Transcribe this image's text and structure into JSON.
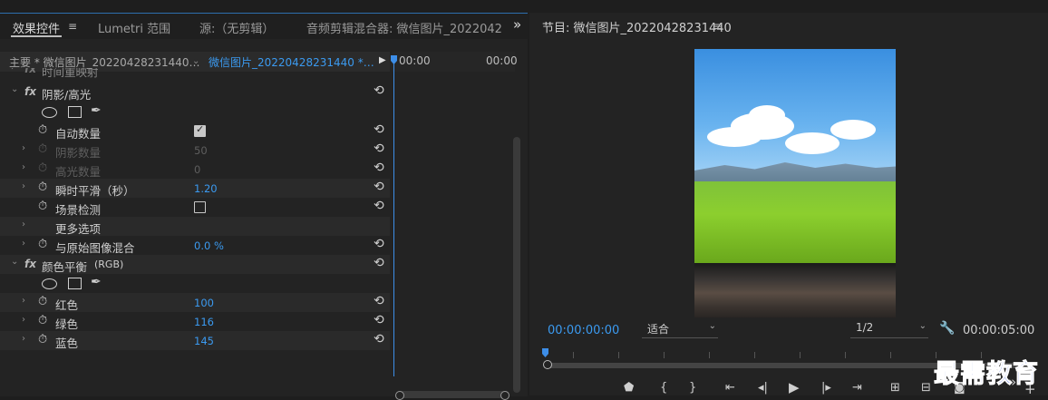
{
  "tabs": [
    "效果控件",
    "Lumetri 范围",
    "源:（无剪辑）",
    "音频剪辑混合器: 微信图片_2022042"
  ],
  "panel_overflow": "»",
  "clip": {
    "master": "主要 * 微信图片_20220428231440…",
    "sequence": "微信图片_20220428231440 *…",
    "tc_start": "00:00",
    "tc_end": "00:00"
  },
  "effects": {
    "partial_row": "时间重映射",
    "shadow_highlight": {
      "title": "阴影/高光",
      "auto_amount": {
        "label": "自动数量",
        "checked": true
      },
      "shadow_amount": {
        "label": "阴影数量",
        "value": "50"
      },
      "highlight_amount": {
        "label": "高光数量",
        "value": "0"
      },
      "temporal_smoothing": {
        "label": "瞬时平滑（秒）",
        "value": "1.20"
      },
      "scene_detect": {
        "label": "场景检测",
        "checked": false
      },
      "more_options": {
        "label": "更多选项"
      },
      "blend_original": {
        "label": "与原始图像混合",
        "value": "0.0 %"
      }
    },
    "color_balance": {
      "title": "颜色平衡",
      "suffix": "(RGB)",
      "red": {
        "label": "红色",
        "value": "100"
      },
      "green": {
        "label": "绿色",
        "value": "116"
      },
      "blue": {
        "label": "蓝色",
        "value": "145"
      }
    }
  },
  "program": {
    "title": "节目: 微信图片_20220428231440",
    "timecode_current": "00:00:00:00",
    "fit": "适合",
    "resolution": "1/2",
    "timecode_duration": "00:00:05:00"
  },
  "watermark": "最需教育",
  "colors": {
    "accent": "#3b9af0",
    "panel": "#232323",
    "watermark": "#1a3fd6"
  }
}
